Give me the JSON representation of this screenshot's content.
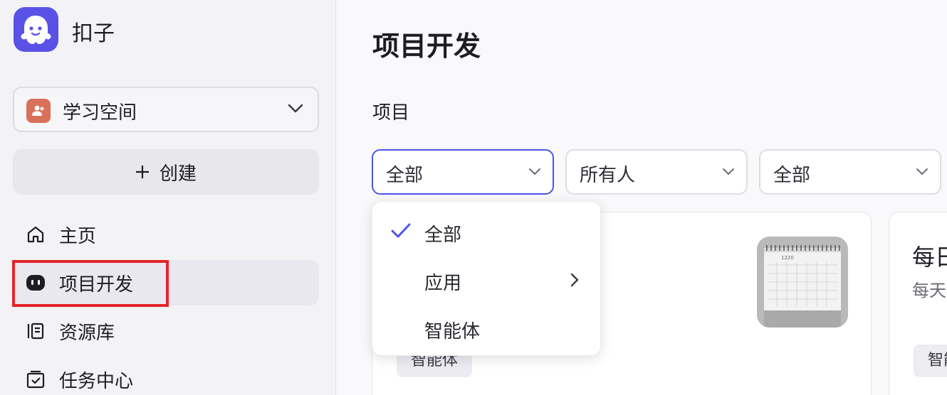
{
  "app": {
    "name": "扣子"
  },
  "sidebar": {
    "space": {
      "label": "学习空间"
    },
    "create_label": "创建",
    "nav": [
      {
        "label": "主页",
        "icon": "home-icon"
      },
      {
        "label": "项目开发",
        "icon": "bot-icon",
        "active": true
      },
      {
        "label": "资源库",
        "icon": "library-icon"
      },
      {
        "label": "任务中心",
        "icon": "task-icon"
      }
    ]
  },
  "main": {
    "title": "项目开发",
    "section": "项目",
    "filters": [
      {
        "value": "全部"
      },
      {
        "value": "所有人"
      },
      {
        "value": "全部"
      }
    ],
    "dropdown": {
      "items": [
        {
          "label": "全部",
          "selected": true
        },
        {
          "label": "应用",
          "has_submenu": true
        },
        {
          "label": "智能体"
        }
      ]
    },
    "cards": [
      {
        "tag": "智能体"
      },
      {
        "title": "每日",
        "subtitle": "每天",
        "tag": "智能"
      }
    ]
  },
  "colors": {
    "accent": "#4d53e8",
    "logo": "#5a52e6",
    "highlight": "#e3242b"
  }
}
